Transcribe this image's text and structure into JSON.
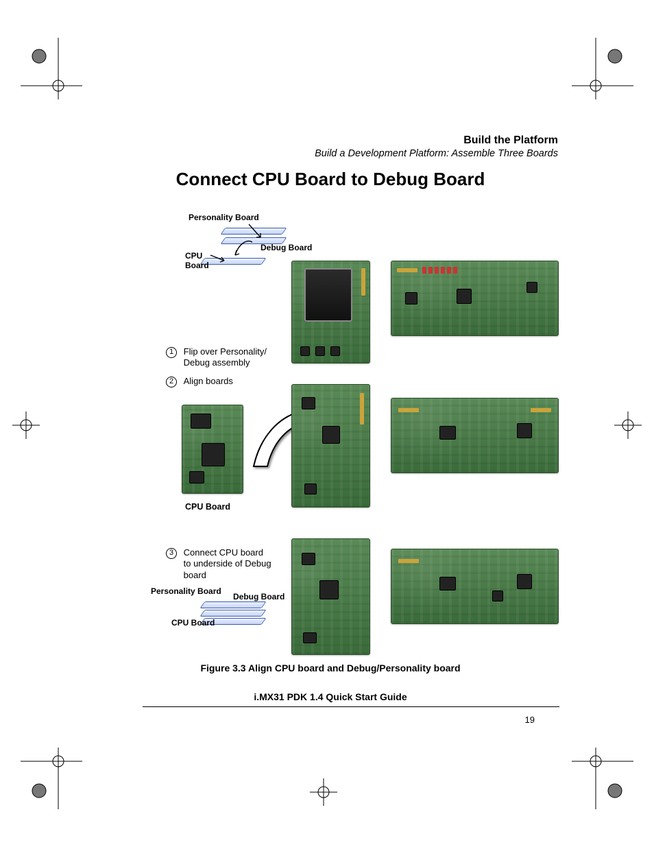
{
  "runhead": {
    "title": "Build the Platform",
    "subtitle": "Build a Development Platform: Assemble Three Boards"
  },
  "headline": "Connect CPU Board to Debug Board",
  "schematic_labels": {
    "personality": "Personality Board",
    "debug": "Debug Board",
    "cpu": "CPU",
    "board": "Board",
    "cpu_board": "CPU Board"
  },
  "steps": {
    "s1": {
      "n": "1",
      "text": "Flip over Personality/ Debug assembly"
    },
    "s2": {
      "n": "2",
      "text": "Align boards"
    },
    "s3": {
      "n": "3",
      "text": "Connect CPU board to underside of Debug board"
    }
  },
  "cpu_label": "CPU Board",
  "figure_caption": "Figure 3.3   Align CPU board and Debug/Personality board",
  "guide_title": "i.MX31 PDK 1.4 Quick Start Guide",
  "page_number": "19"
}
